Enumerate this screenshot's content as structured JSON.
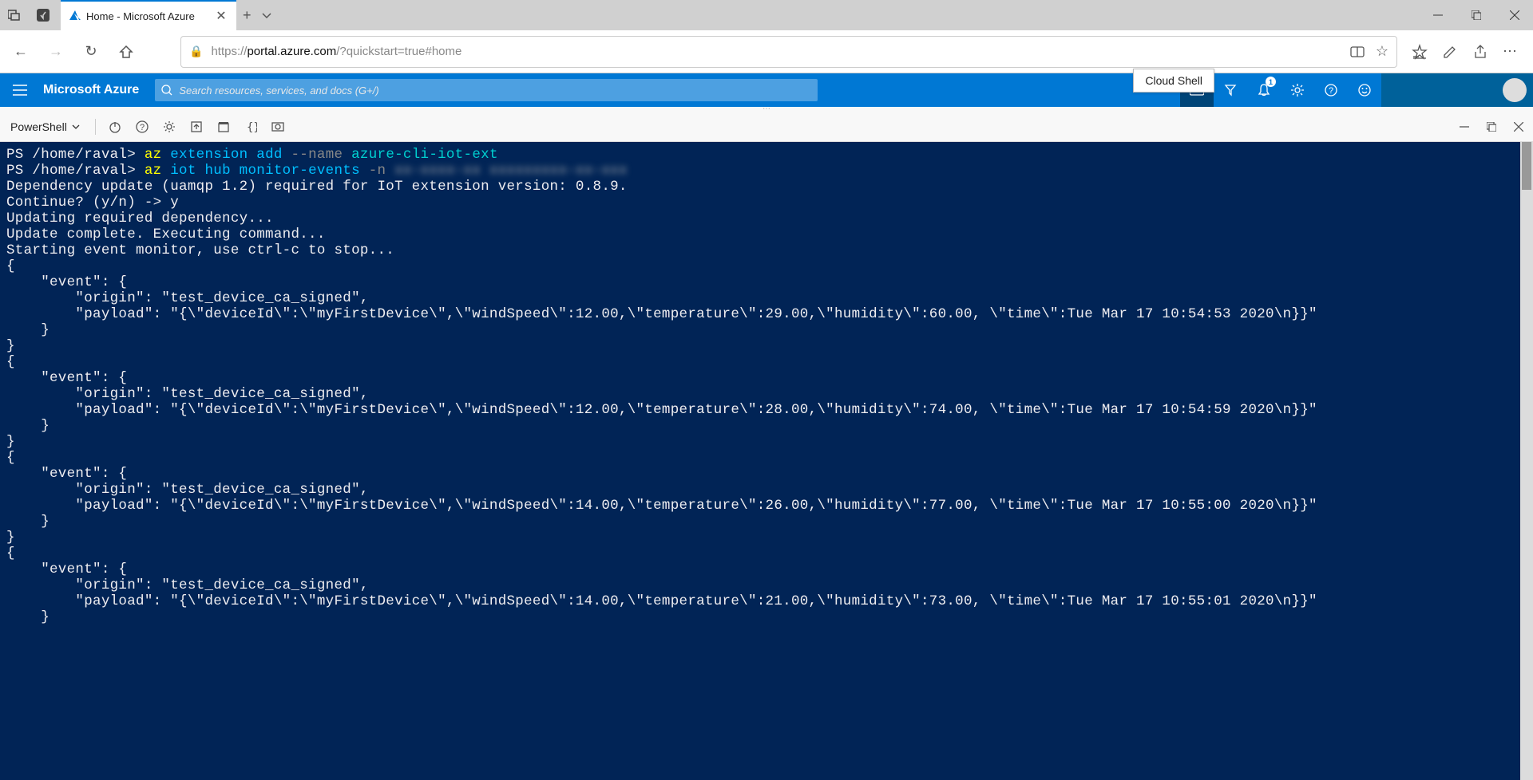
{
  "browser": {
    "tab_title": "Home - Microsoft Azure",
    "url_prefix": "https://",
    "url_host": "portal.azure.com",
    "url_path": "/?quickstart=true#home",
    "tooltip": "Cloud Shell"
  },
  "azure": {
    "brand": "Microsoft Azure",
    "search_placeholder": "Search resources, services, and docs (G+/)",
    "notification_count": "1"
  },
  "shell": {
    "selector": "PowerShell"
  },
  "terminal": {
    "prompt_prefix": "PS ",
    "prompt_path": "/home/raval>",
    "line1_cmd_a": "az",
    "line1_cmd_b": " extension add",
    "line1_arg": " --name",
    "line1_lit": " azure-cli-iot-ext",
    "line2_cmd_a": "az",
    "line2_cmd_b": " iot hub monitor-events",
    "line2_arg": " -n",
    "line2_blur": " xx-xxxx-xx xxxxxxxxx-xx-xxx",
    "line3": "Dependency update (uamqp 1.2) required for IoT extension version: 0.8.9.",
    "line4": "Continue? (y/n) -> y",
    "line5": "Updating required dependency...",
    "line6": "Update complete. Executing command...",
    "line7": "Starting event monitor, use ctrl-c to stop...",
    "event_open": "{",
    "event_hdr": "    \"event\": {",
    "event_origin": "        \"origin\": \"test_device_ca_signed\",",
    "payload1": "        \"payload\": \"{\\\"deviceId\\\":\\\"myFirstDevice\\\",\\\"windSpeed\\\":12.00,\\\"temperature\\\":29.00,\\\"humidity\\\":60.00, \\\"time\\\":Tue Mar 17 10:54:53 2020\\n}}\"",
    "payload2": "        \"payload\": \"{\\\"deviceId\\\":\\\"myFirstDevice\\\",\\\"windSpeed\\\":12.00,\\\"temperature\\\":28.00,\\\"humidity\\\":74.00, \\\"time\\\":Tue Mar 17 10:54:59 2020\\n}}\"",
    "payload3": "        \"payload\": \"{\\\"deviceId\\\":\\\"myFirstDevice\\\",\\\"windSpeed\\\":14.00,\\\"temperature\\\":26.00,\\\"humidity\\\":77.00, \\\"time\\\":Tue Mar 17 10:55:00 2020\\n}}\"",
    "payload4": "        \"payload\": \"{\\\"deviceId\\\":\\\"myFirstDevice\\\",\\\"windSpeed\\\":14.00,\\\"temperature\\\":21.00,\\\"humidity\\\":73.00, \\\"time\\\":Tue Mar 17 10:55:01 2020\\n}}\"",
    "event_close_inner": "    }",
    "event_close_outer": "}"
  }
}
